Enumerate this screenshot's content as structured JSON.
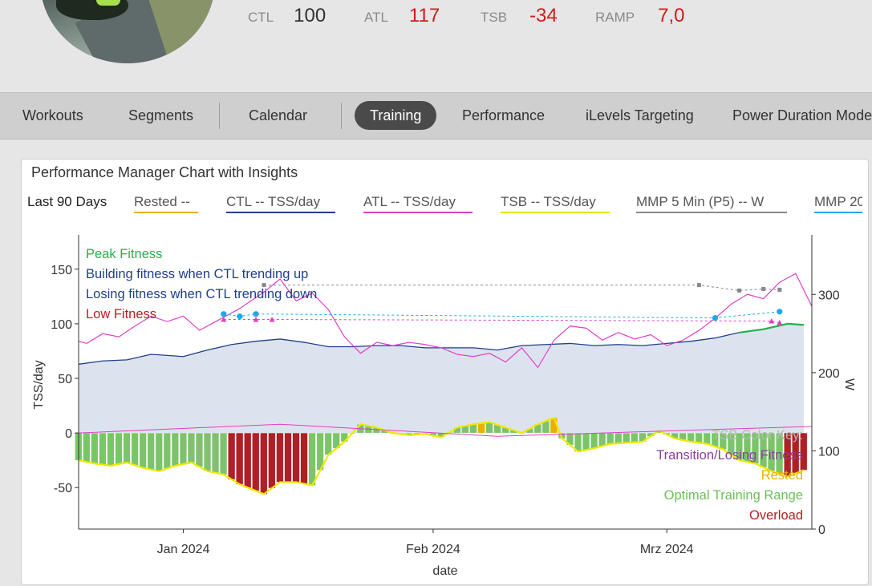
{
  "metrics": [
    {
      "label": "CTL",
      "value": "100",
      "color": "#333333"
    },
    {
      "label": "ATL",
      "value": "117",
      "color": "#d01c1c"
    },
    {
      "label": "TSB",
      "value": "-34",
      "color": "#d01c1c"
    },
    {
      "label": "RAMP",
      "value": "7,0",
      "color": "#d01c1c"
    }
  ],
  "tabs": [
    {
      "label": "Workouts"
    },
    {
      "label": "Segments"
    },
    {
      "label": "Calendar"
    },
    {
      "label": "Training",
      "active": true
    },
    {
      "label": "Performance"
    },
    {
      "label": "iLevels Targeting"
    },
    {
      "label": "Power Duration Mode"
    }
  ],
  "card": {
    "title": "Performance Manager Chart with Insights",
    "period": "Last 90 Days",
    "legend": [
      {
        "label": "Rested  --",
        "color": "#e8b000"
      },
      {
        "label": "CTL  -- TSS/day",
        "color": "#1f3f8a"
      },
      {
        "label": "ATL  -- TSS/day",
        "color": "#e040c8"
      },
      {
        "label": "TSB  -- TSS/day",
        "color": "#e8e000"
      },
      {
        "label": "MMP 5 Min (P5)  -- W",
        "color": "#888888"
      },
      {
        "label": "MMP 20",
        "color": "#1ea8e8"
      }
    ]
  },
  "insights": {
    "fitness": [
      {
        "text": "Peak Fitness",
        "color": "#22b24c"
      },
      {
        "text": "Building fitness when CTL trending up",
        "color": "#1f3f8a"
      },
      {
        "text": "Losing fitness when CTL trending down",
        "color": "#1f3f8a"
      },
      {
        "text": "Low Fitness",
        "color": "#b22222"
      }
    ],
    "tsb_key_title": "TSB Color Key:",
    "tsb_key": [
      {
        "text": "Transition/Losing Fitness",
        "color": "#8a3fa0"
      },
      {
        "text": "Rested",
        "color": "#e8b000"
      },
      {
        "text": "Optimal Training Range",
        "color": "#6cbf5a"
      },
      {
        "text": "Overload",
        "color": "#b22222"
      }
    ]
  },
  "chart_data": {
    "type": "line",
    "xlabel": "date",
    "ylabel": "TSS/day",
    "y2label": "W",
    "ylim": [
      -88,
      177
    ],
    "y2lim": [
      0,
      370
    ],
    "yticks": [
      -50,
      0,
      50,
      100,
      150
    ],
    "y2ticks": [
      0,
      100,
      200,
      300
    ],
    "x_range": [
      "2023-12-19",
      "2024-03-19"
    ],
    "xticks": [
      {
        "date": "2024-01-01",
        "label": "Jan 2024"
      },
      {
        "date": "2024-02-01",
        "label": "Feb 2024"
      },
      {
        "date": "2024-03-01",
        "label": "Mrz 2024"
      }
    ],
    "ctl": [
      [
        "2023-12-19",
        63
      ],
      [
        "2023-12-22",
        66
      ],
      [
        "2023-12-25",
        67
      ],
      [
        "2023-12-28",
        72
      ],
      [
        "2024-01-01",
        70
      ],
      [
        "2024-01-04",
        76
      ],
      [
        "2024-01-07",
        81
      ],
      [
        "2024-01-10",
        84
      ],
      [
        "2024-01-13",
        86
      ],
      [
        "2024-01-16",
        83
      ],
      [
        "2024-01-19",
        79
      ],
      [
        "2024-01-22",
        79
      ],
      [
        "2024-01-25",
        80
      ],
      [
        "2024-01-28",
        80
      ],
      [
        "2024-01-31",
        78
      ],
      [
        "2024-02-03",
        78
      ],
      [
        "2024-02-06",
        78
      ],
      [
        "2024-02-09",
        76
      ],
      [
        "2024-02-12",
        80
      ],
      [
        "2024-02-15",
        81
      ],
      [
        "2024-02-18",
        82
      ],
      [
        "2024-02-21",
        80
      ],
      [
        "2024-02-24",
        81
      ],
      [
        "2024-02-27",
        80
      ],
      [
        "2024-03-01",
        82
      ],
      [
        "2024-03-04",
        84
      ],
      [
        "2024-03-07",
        87
      ],
      [
        "2024-03-10",
        92
      ],
      [
        "2024-03-13",
        95
      ],
      [
        "2024-03-16",
        100
      ],
      [
        "2024-03-18",
        99
      ]
    ],
    "peak_fitness_from": "2024-03-08",
    "atl": [
      [
        "2023-12-19",
        84
      ],
      [
        "2023-12-20",
        82
      ],
      [
        "2023-12-22",
        91
      ],
      [
        "2023-12-24",
        88
      ],
      [
        "2023-12-26",
        98
      ],
      [
        "2023-12-28",
        107
      ],
      [
        "2023-12-30",
        102
      ],
      [
        "2024-01-01",
        107
      ],
      [
        "2024-01-03",
        94
      ],
      [
        "2024-01-05",
        102
      ],
      [
        "2024-01-08",
        114
      ],
      [
        "2024-01-11",
        129
      ],
      [
        "2024-01-13",
        141
      ],
      [
        "2024-01-15",
        121
      ],
      [
        "2024-01-17",
        128
      ],
      [
        "2024-01-19",
        113
      ],
      [
        "2024-01-21",
        88
      ],
      [
        "2024-01-23",
        73
      ],
      [
        "2024-01-25",
        83
      ],
      [
        "2024-01-27",
        80
      ],
      [
        "2024-01-29",
        83
      ],
      [
        "2024-01-31",
        81
      ],
      [
        "2024-02-02",
        78
      ],
      [
        "2024-02-04",
        72
      ],
      [
        "2024-02-06",
        70
      ],
      [
        "2024-02-08",
        73
      ],
      [
        "2024-02-10",
        65
      ],
      [
        "2024-02-12",
        78
      ],
      [
        "2024-02-14",
        60
      ],
      [
        "2024-02-16",
        85
      ],
      [
        "2024-02-18",
        98
      ],
      [
        "2024-02-20",
        96
      ],
      [
        "2024-02-22",
        85
      ],
      [
        "2024-02-24",
        92
      ],
      [
        "2024-02-26",
        86
      ],
      [
        "2024-02-28",
        90
      ],
      [
        "2024-03-01",
        80
      ],
      [
        "2024-03-03",
        85
      ],
      [
        "2024-03-05",
        94
      ],
      [
        "2024-03-07",
        105
      ],
      [
        "2024-03-09",
        118
      ],
      [
        "2024-03-11",
        127
      ],
      [
        "2024-03-13",
        123
      ],
      [
        "2024-03-15",
        138
      ],
      [
        "2024-03-17",
        146
      ],
      [
        "2024-03-19",
        116
      ]
    ],
    "tsb": [
      [
        "2023-12-19",
        -25
      ],
      [
        "2023-12-21",
        -28
      ],
      [
        "2023-12-23",
        -30
      ],
      [
        "2023-12-25",
        -27
      ],
      [
        "2023-12-27",
        -32
      ],
      [
        "2023-12-29",
        -35
      ],
      [
        "2023-12-31",
        -30
      ],
      [
        "2024-01-02",
        -27
      ],
      [
        "2024-01-04",
        -35
      ],
      [
        "2024-01-06",
        -38
      ],
      [
        "2024-01-08",
        -47
      ],
      [
        "2024-01-10",
        -53
      ],
      [
        "2024-01-11",
        -56
      ],
      [
        "2024-01-13",
        -45
      ],
      [
        "2024-01-15",
        -45
      ],
      [
        "2024-01-17",
        -48
      ],
      [
        "2024-01-19",
        -20
      ],
      [
        "2024-01-21",
        -8
      ],
      [
        "2024-01-23",
        8
      ],
      [
        "2024-01-25",
        5
      ],
      [
        "2024-01-27",
        0
      ],
      [
        "2024-01-29",
        -2
      ],
      [
        "2024-01-31",
        -1
      ],
      [
        "2024-02-02",
        -4
      ],
      [
        "2024-02-04",
        5
      ],
      [
        "2024-02-06",
        8
      ],
      [
        "2024-02-08",
        10
      ],
      [
        "2024-02-10",
        5
      ],
      [
        "2024-02-12",
        0
      ],
      [
        "2024-02-14",
        8
      ],
      [
        "2024-02-16",
        14
      ],
      [
        "2024-02-17",
        -5
      ],
      [
        "2024-02-19",
        -17
      ],
      [
        "2024-02-21",
        -14
      ],
      [
        "2024-02-23",
        -10
      ],
      [
        "2024-02-25",
        -9
      ],
      [
        "2024-02-27",
        -8
      ],
      [
        "2024-02-29",
        2
      ],
      [
        "2024-03-02",
        -5
      ],
      [
        "2024-03-04",
        -8
      ],
      [
        "2024-03-06",
        -10
      ],
      [
        "2024-03-08",
        -15
      ],
      [
        "2024-03-10",
        -25
      ],
      [
        "2024-03-12",
        -28
      ],
      [
        "2024-03-14",
        -35
      ],
      [
        "2024-03-16",
        -40
      ],
      [
        "2024-03-18",
        -34
      ]
    ],
    "overload_ranges": [
      [
        "2024-01-07",
        "2024-01-16"
      ],
      [
        "2024-03-16",
        "2024-03-18"
      ]
    ],
    "rested_ranges": [
      [
        "2024-02-07",
        "2024-02-07"
      ],
      [
        "2024-02-16",
        "2024-02-16"
      ]
    ],
    "mmp5": [
      [
        "2024-01-11",
        312
      ],
      [
        "2024-03-05",
        312
      ],
      [
        "2024-03-10",
        305
      ],
      [
        "2024-03-13",
        307
      ],
      [
        "2024-03-15",
        306
      ]
    ],
    "mmp20": [
      [
        "2024-01-06",
        275
      ],
      [
        "2024-01-08",
        272
      ],
      [
        "2024-01-10",
        275
      ],
      [
        "2024-03-07",
        270
      ],
      [
        "2024-03-15",
        278
      ]
    ],
    "mmp_pink": [
      [
        "2024-01-06",
        268
      ],
      [
        "2024-01-10",
        268
      ],
      [
        "2024-01-12",
        268
      ],
      [
        "2024-03-14",
        266
      ],
      [
        "2024-03-15",
        264
      ]
    ]
  }
}
